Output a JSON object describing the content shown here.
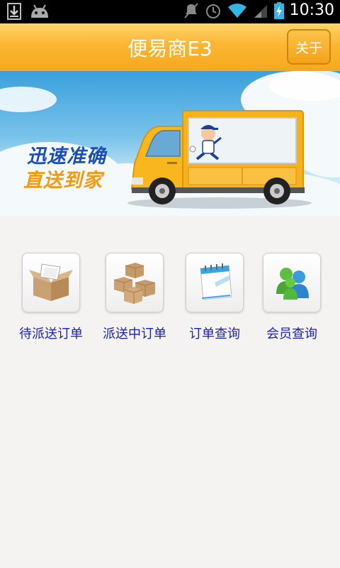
{
  "status_bar": {
    "time": "10:30",
    "icons": [
      "download-icon",
      "android-icon",
      "mute-icon",
      "alarm-icon",
      "wifi-icon",
      "signal-icon",
      "battery-charging-icon"
    ]
  },
  "header": {
    "title": "便易商E3",
    "about_label": "关于"
  },
  "banner": {
    "slogan_line1": "迅速准确",
    "slogan_line2": "直送到家"
  },
  "menu": [
    {
      "label": "待派送订单",
      "icon": "open-box-icon"
    },
    {
      "label": "派送中订单",
      "icon": "boxes-icon"
    },
    {
      "label": "订单查询",
      "icon": "notepad-icon"
    },
    {
      "label": "会员查询",
      "icon": "members-icon"
    }
  ],
  "colors": {
    "accent": "#f7a81c",
    "menu_label": "#1c23b0",
    "slogan_blue": "#1b4fb0",
    "slogan_orange": "#f39a12"
  }
}
